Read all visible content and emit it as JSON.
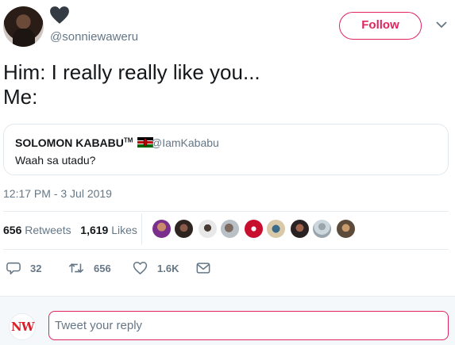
{
  "author": {
    "handle": "@sonniewaweru",
    "follow_label": "Follow"
  },
  "tweet": {
    "lines": [
      "Him: I really really like you...",
      "Me:"
    ],
    "timestamp": "12:17 PM - 3 Jul 2019"
  },
  "quote": {
    "name": "SOLOMON KABABU",
    "tm": "TM",
    "handle": "@IamKababu",
    "text": "Waah sa utadu?"
  },
  "stats": {
    "retweets_count": "656",
    "retweets_label": "Retweets",
    "likes_count": "1,619",
    "likes_label": "Likes"
  },
  "actions": {
    "replies": "32",
    "retweets": "656",
    "likes": "1.6K"
  },
  "reply": {
    "placeholder": "Tweet your reply",
    "logo_text": "NW"
  },
  "colors": {
    "accent": "#e0245e",
    "secondary_text": "#657786",
    "border": "#e1e8ed"
  },
  "icons": {
    "heart": "heart-icon",
    "chevron": "chevron-down-icon",
    "reply": "reply-icon",
    "retweet": "retweet-icon",
    "like": "like-icon",
    "dm": "envelope-icon"
  }
}
